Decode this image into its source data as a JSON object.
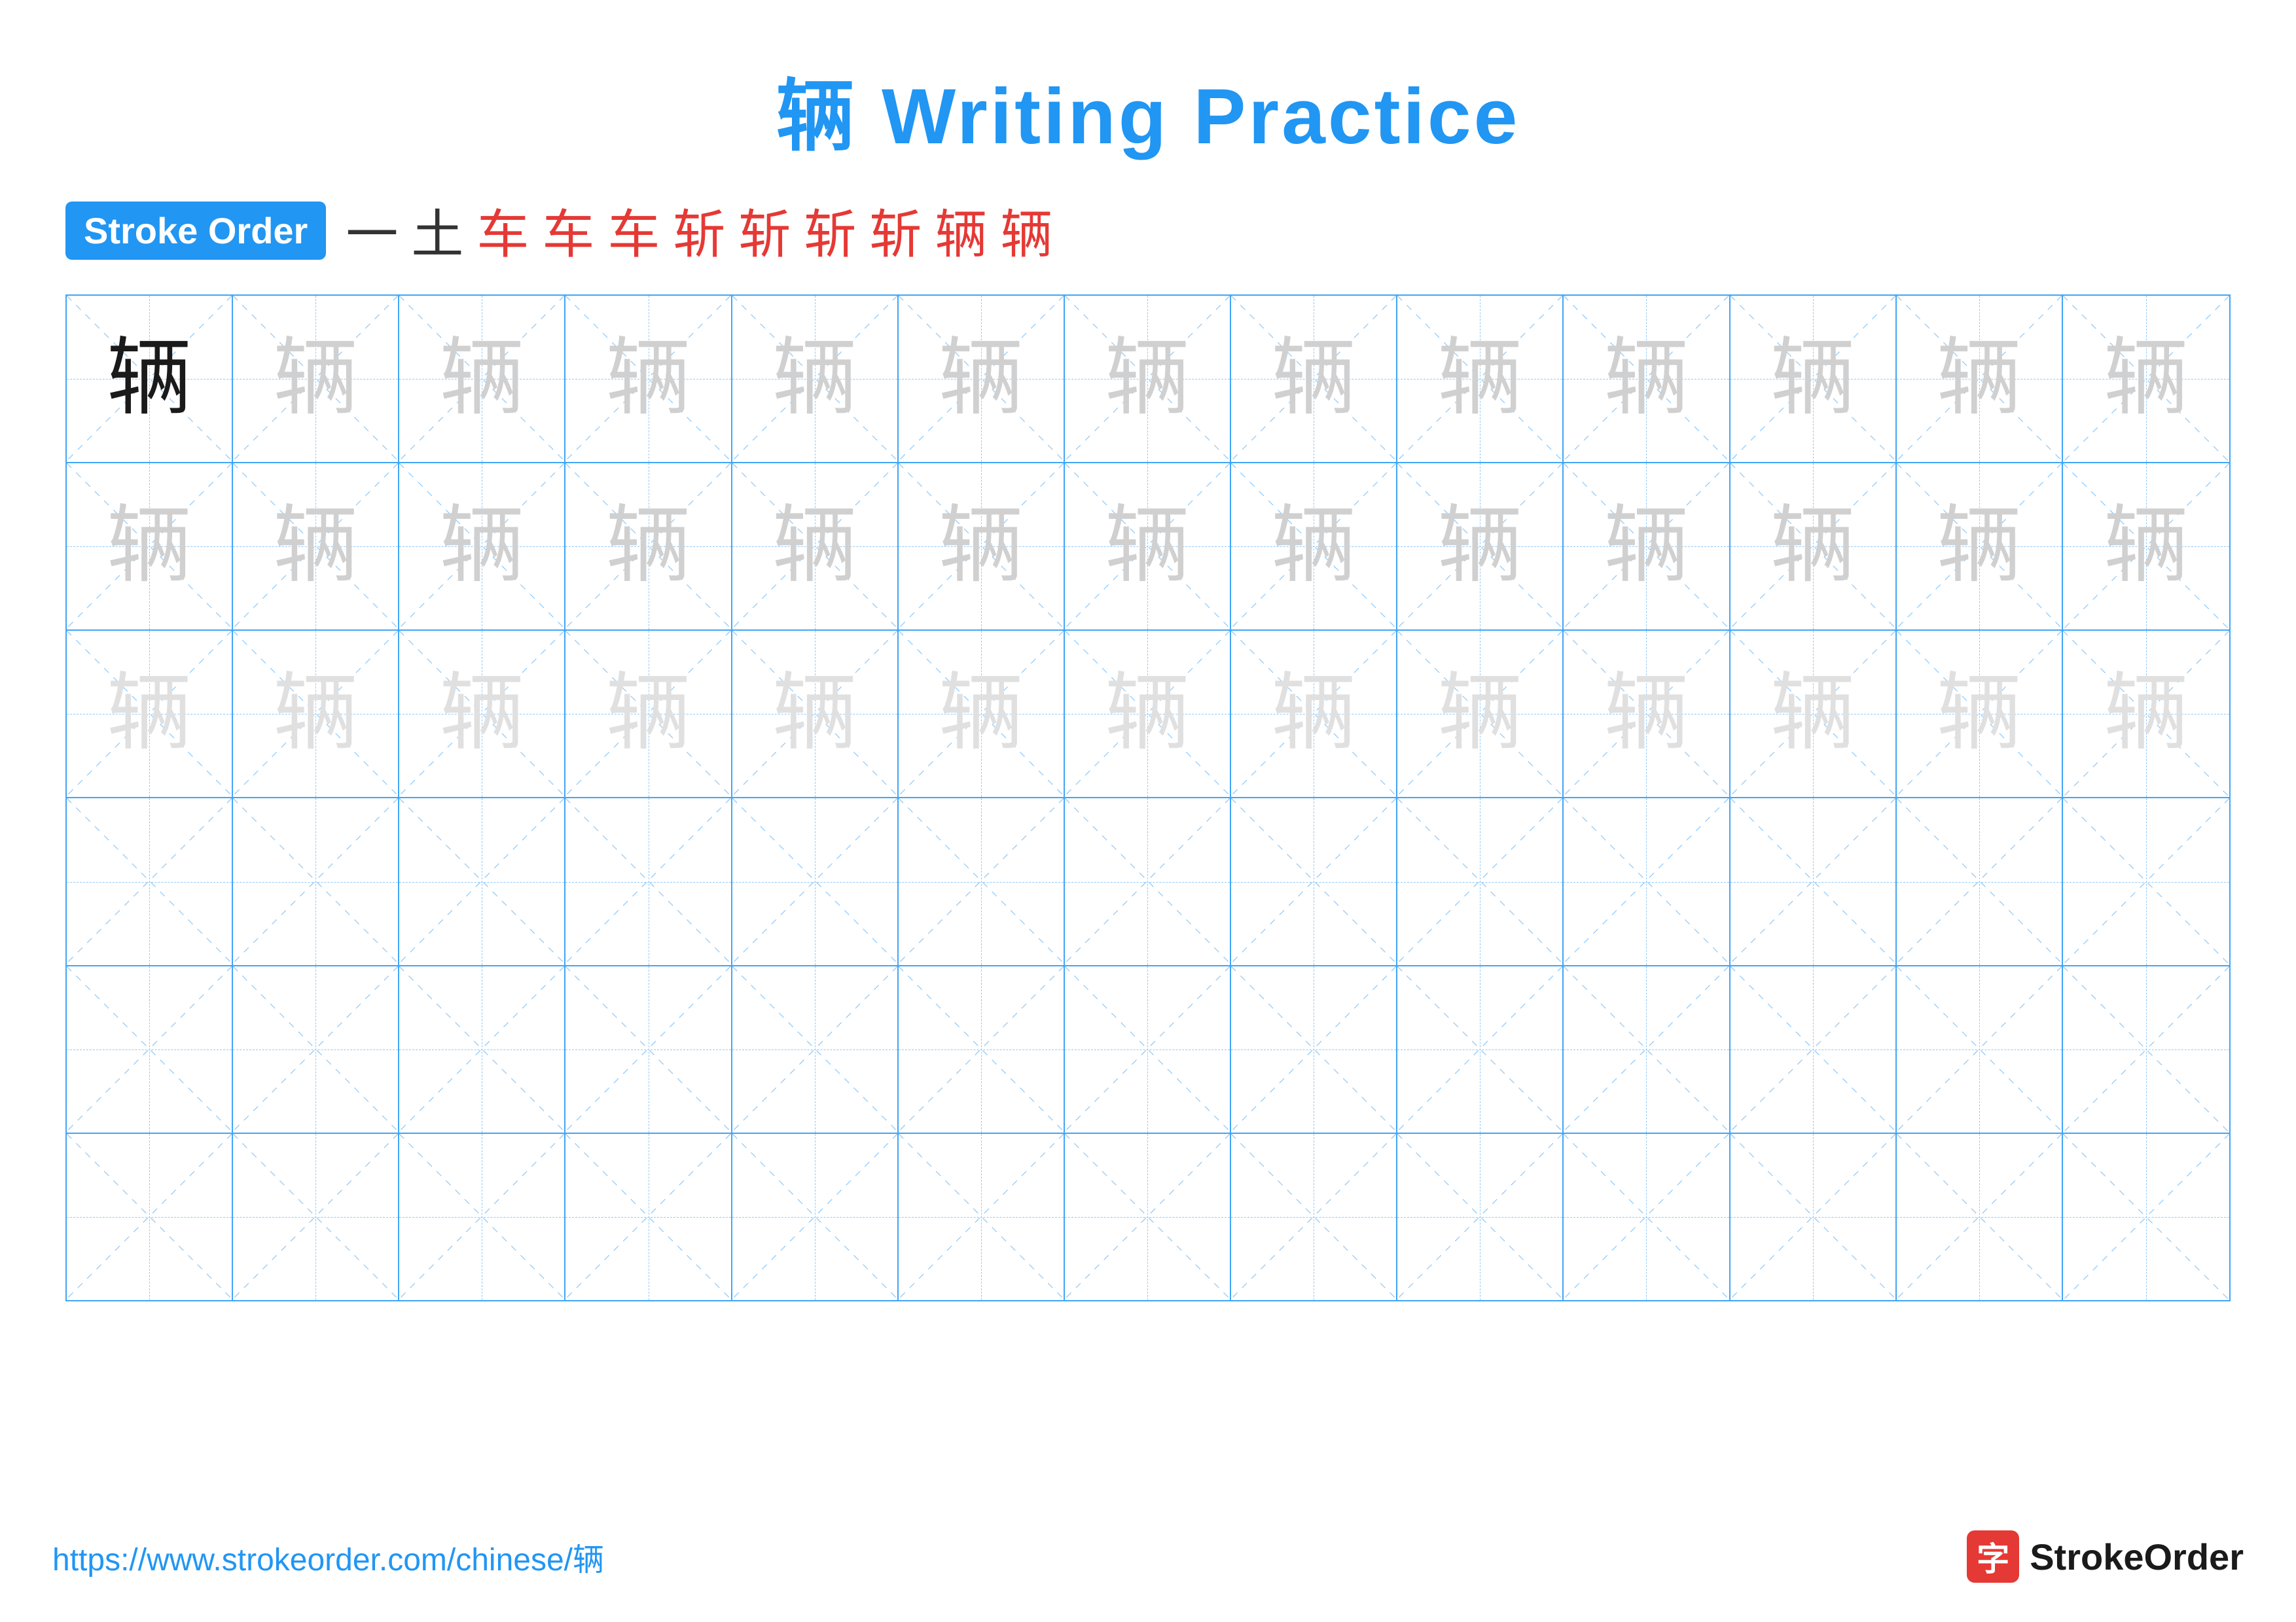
{
  "title": "辆 Writing Practice",
  "stroke_order": {
    "badge_label": "Stroke Order",
    "strokes": [
      "一",
      "土",
      "车",
      "车",
      "车",
      "斩",
      "斩",
      "斩",
      "斩",
      "辆",
      "辆"
    ]
  },
  "grid": {
    "rows": 6,
    "cols": 13,
    "char": "辆",
    "row_styles": [
      "dark",
      "light",
      "lighter",
      "empty",
      "empty",
      "empty"
    ]
  },
  "footer": {
    "url": "https://www.strokeorder.com/chinese/辆",
    "logo_icon": "字",
    "logo_text": "StrokeOrder"
  }
}
